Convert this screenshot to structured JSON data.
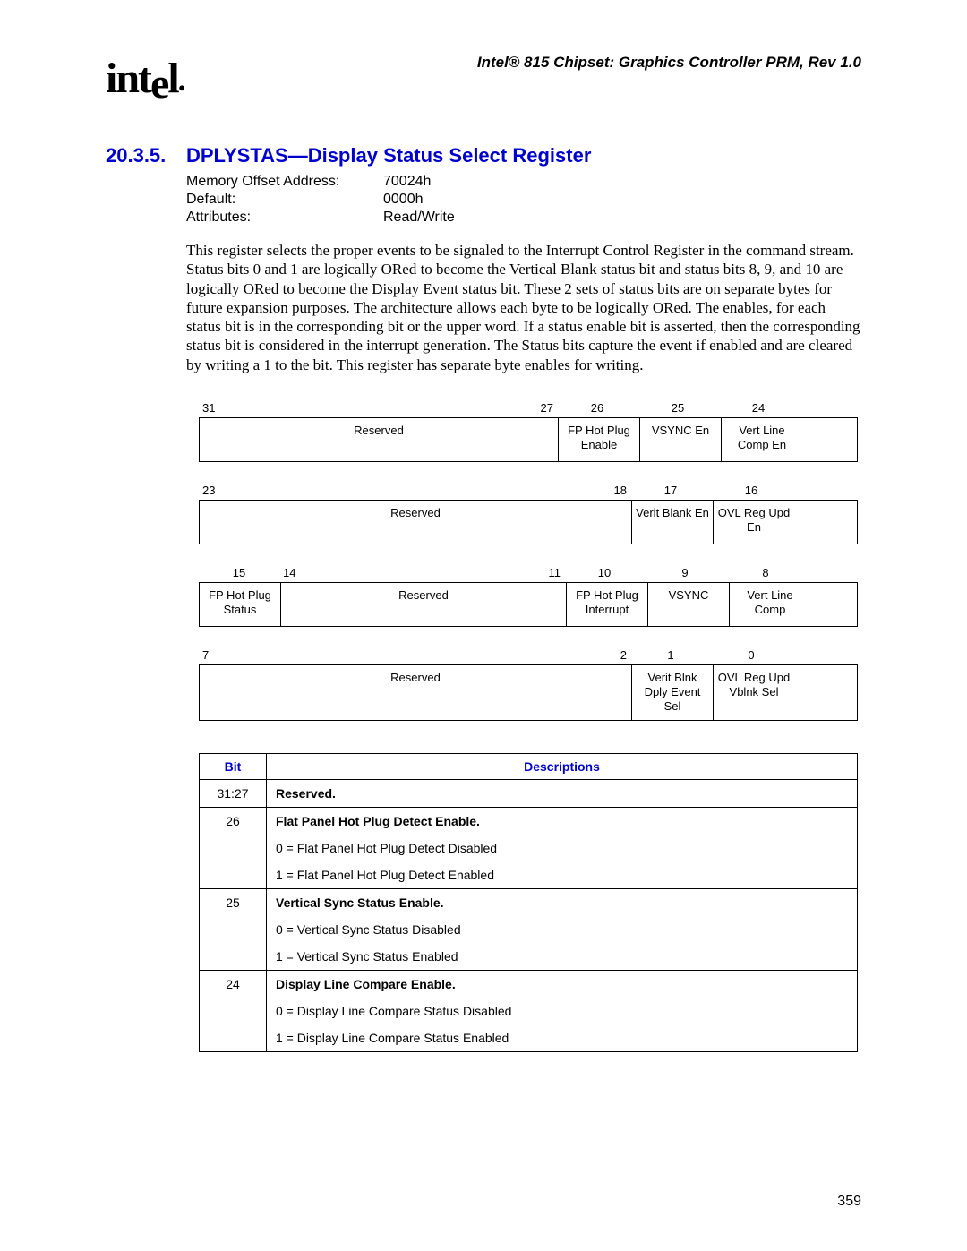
{
  "header": "Intel® 815 Chipset: Graphics Controller PRM, Rev 1.0",
  "logo": "intel",
  "section": {
    "num": "20.3.5.",
    "title": "DPLYSTAS—Display Status Select Register"
  },
  "meta": {
    "addr_label": "Memory Offset Address:",
    "addr_value": "70024h",
    "default_label": "Default:",
    "default_value": "0000h",
    "attr_label": "Attributes:",
    "attr_value": "Read/Write"
  },
  "paragraph": "This register selects the proper events to be signaled to the Interrupt Control Register in the command stream. Status bits 0 and 1 are logically ORed to become the Vertical Blank status bit and status bits 8, 9, and 10 are logically ORed to become the Display Event status bit. These 2 sets of status bits are on separate bytes for future expansion purposes. The architecture allows each byte to be logically ORed. The enables, for each status bit is in the corresponding bit or the upper word. If a status enable bit is asserted, then the corresponding status bit is considered in the interrupt generation. The Status bits capture the event if enabled and are cleared by writing a 1 to the bit. This register has separate byte enables for writing.",
  "rows": [
    {
      "bits": [
        "31",
        "27",
        "26",
        "25",
        "24"
      ],
      "cells": [
        "Reserved",
        "FP Hot Plug Enable",
        "VSYNC En",
        "Vert Line Comp En"
      ]
    },
    {
      "bits": [
        "23",
        "18",
        "17",
        "16"
      ],
      "cells": [
        "Reserved",
        "Verit Blank En",
        "OVL Reg Upd En"
      ]
    },
    {
      "bits": [
        "15",
        "14",
        "11",
        "10",
        "9",
        "8"
      ],
      "cells": [
        "FP Hot Plug Status",
        "Reserved",
        "FP Hot Plug Interrupt",
        "VSYNC",
        "Vert Line Comp"
      ]
    },
    {
      "bits": [
        "7",
        "2",
        "1",
        "0"
      ],
      "cells": [
        "Reserved",
        "Verit Blnk Dply Event Sel",
        "OVL Reg Upd Vblnk Sel"
      ]
    }
  ],
  "desc": {
    "head_bit": "Bit",
    "head_desc": "Descriptions",
    "rows": [
      {
        "bit": "31:27",
        "lines": [
          "Reserved."
        ],
        "bold": [
          0
        ]
      },
      {
        "bit": "26",
        "lines": [
          "Flat Panel Hot Plug Detect Enable.",
          "0 = Flat Panel Hot Plug Detect Disabled",
          "1 = Flat Panel Hot Plug Detect Enabled"
        ],
        "bold": [
          0
        ]
      },
      {
        "bit": "25",
        "lines": [
          "Vertical Sync Status Enable.",
          "0 = Vertical Sync Status Disabled",
          "1 = Vertical Sync Status Enabled"
        ],
        "bold": [
          0
        ]
      },
      {
        "bit": "24",
        "lines": [
          "Display Line Compare Enable.",
          "0 = Display Line Compare Status Disabled",
          "1 = Display Line Compare Status Enabled"
        ],
        "bold": [
          0
        ]
      }
    ]
  },
  "page_number": "359"
}
